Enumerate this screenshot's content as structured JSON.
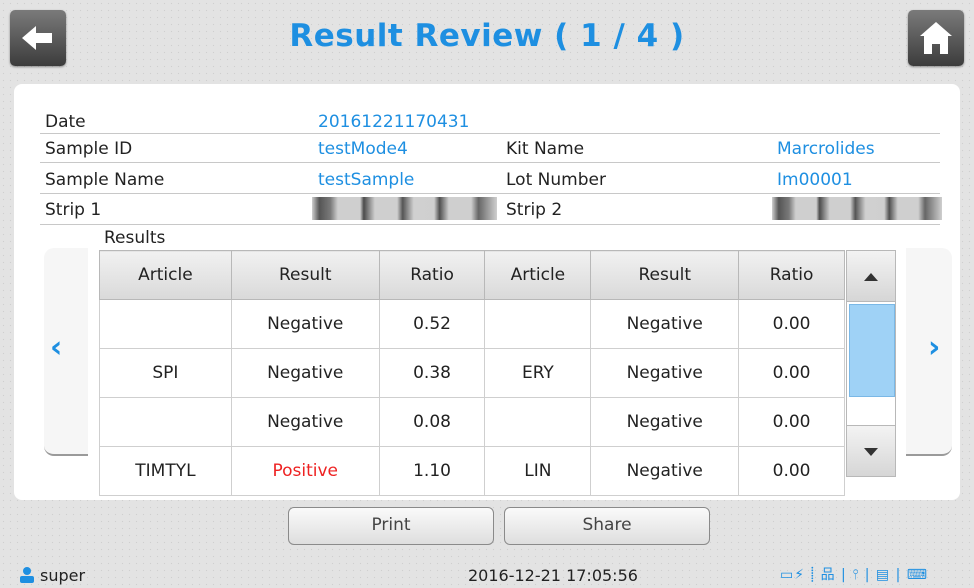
{
  "header": {
    "title": "Result Review ( 1 / 4 )",
    "back_icon": "back-arrow-icon",
    "home_icon": "home-icon"
  },
  "info": {
    "date_label": "Date",
    "date_value": "20161221170431",
    "sample_id_label": "Sample ID",
    "sample_id_value": "testMode4",
    "kit_name_label": "Kit Name",
    "kit_name_value": "Marcrolides",
    "sample_name_label": "Sample Name",
    "sample_name_value": "testSample",
    "lot_number_label": "Lot Number",
    "lot_number_value": "Im00001",
    "strip1_label": "Strip 1",
    "strip2_label": "Strip 2"
  },
  "results": {
    "label": "Results",
    "headers": [
      "Article",
      "Result",
      "Ratio",
      "Article",
      "Result",
      "Ratio"
    ],
    "rows": [
      [
        "",
        "Negative",
        "0.52",
        "",
        "Negative",
        "0.00"
      ],
      [
        "SPI",
        "Negative",
        "0.38",
        "ERY",
        "Negative",
        "0.00"
      ],
      [
        "",
        "Negative",
        "0.08",
        "",
        "Negative",
        "0.00"
      ],
      [
        "TIMTYL",
        "Positive",
        "1.10",
        "LIN",
        "Negative",
        "0.00"
      ]
    ]
  },
  "buttons": {
    "print": "Print",
    "share": "Share"
  },
  "status": {
    "user": "super",
    "datetime": "2016-12-21 17:05:56",
    "icons": [
      "battery-icon",
      "network-icon",
      "usb-icon",
      "printer-icon",
      "keyboard-icon"
    ]
  },
  "colors": {
    "accent": "#1e8fe1",
    "positive": "#ee2222"
  }
}
